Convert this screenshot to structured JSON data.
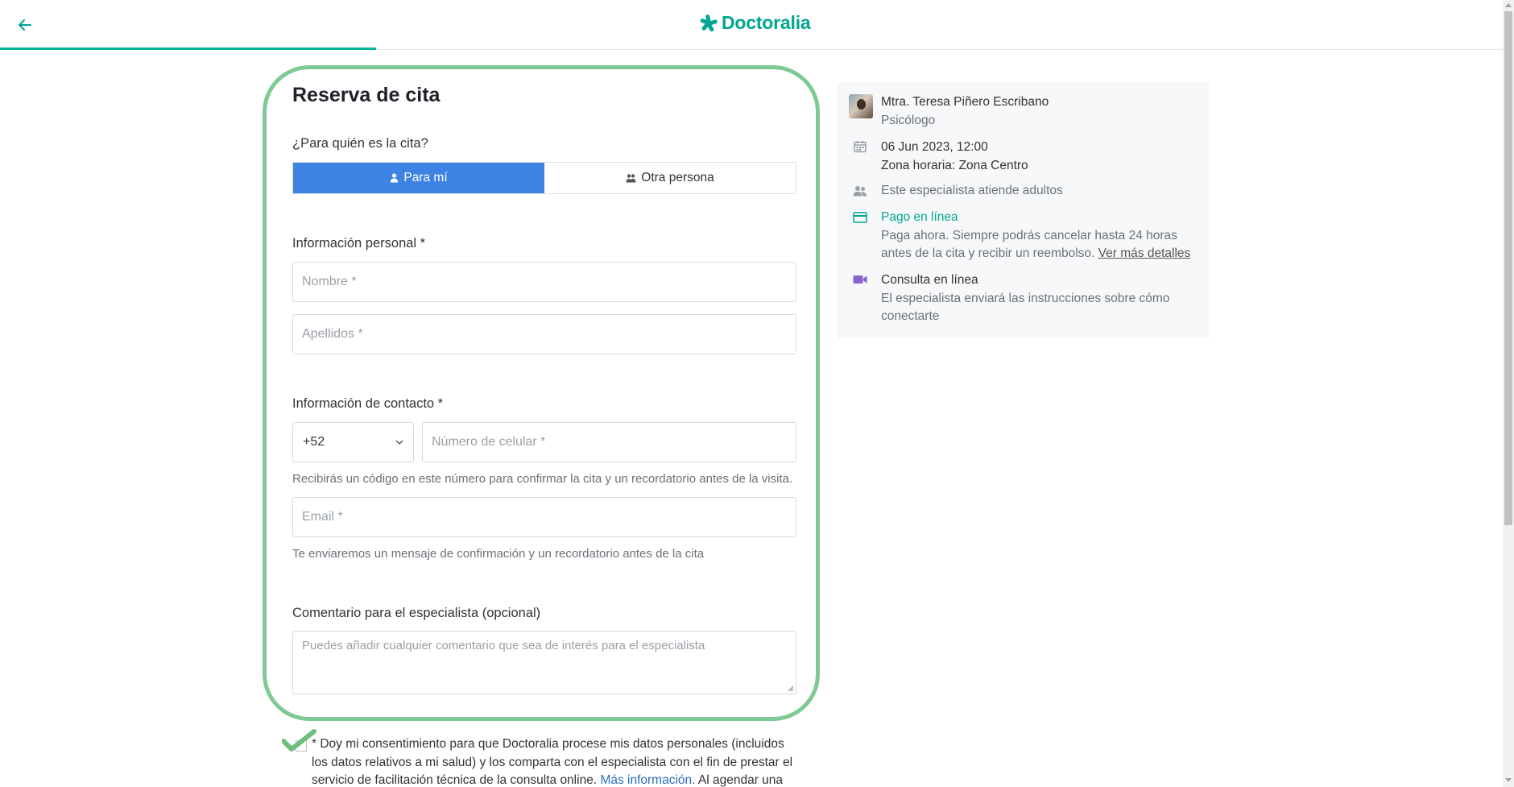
{
  "header": {
    "brand": "Doctoralia",
    "progress_percent": 25
  },
  "form": {
    "title": "Reserva de cita",
    "for_whom_label": "¿Para quién es la cita?",
    "option_me": "Para mí",
    "option_other": "Otra persona",
    "personal_info_label": "Información personal *",
    "name_placeholder": "Nombre *",
    "surname_placeholder": "Apellidos *",
    "contact_info_label": "Información de contacto *",
    "country_code": "+52",
    "phone_placeholder": "Número de celular *",
    "phone_help": "Recibirás un código en este número para confirmar la cita y un recordatorio antes de la visita.",
    "email_placeholder": "Email *",
    "email_help": "Te enviaremos un mensaje de confirmación y un recordatorio antes de la cita",
    "comment_label": "Comentario para el especialista (opcional)",
    "comment_placeholder": "Puedes añadir cualquier comentario que sea de interés para el especialista",
    "consent_text_before": "* Doy mi consentimiento para que Doctoralia procese mis datos personales (incluidos los datos relativos a mi salud) y los comparta con el especialista con el fin de prestar el servicio de facilitación técnica de la consulta online. ",
    "consent_link": "Más información.",
    "consent_text_after": " Al agendar una"
  },
  "summary": {
    "doctor_name": "Mtra. Teresa Piñero Escribano",
    "doctor_specialty": "Psicólogo",
    "date_time": "06 Jun 2023, 12:00",
    "timezone": "Zona horaria: Zona Centro",
    "audience": "Este especialista atiende adultos",
    "payment_title": "Pago en línea",
    "payment_desc": "Paga ahora. Siempre podrás cancelar hasta 24 horas antes de la cita y recibir un reembolso.",
    "payment_link": "Ver más detalles",
    "online_title": "Consulta en línea",
    "online_desc": "El especialista enviará las instrucciones sobre cómo conectarte"
  },
  "colors": {
    "brand": "#00a690",
    "active_option": "#3e83e4",
    "highlight_ring": "#7fc995",
    "video_icon": "#8a63d2"
  }
}
